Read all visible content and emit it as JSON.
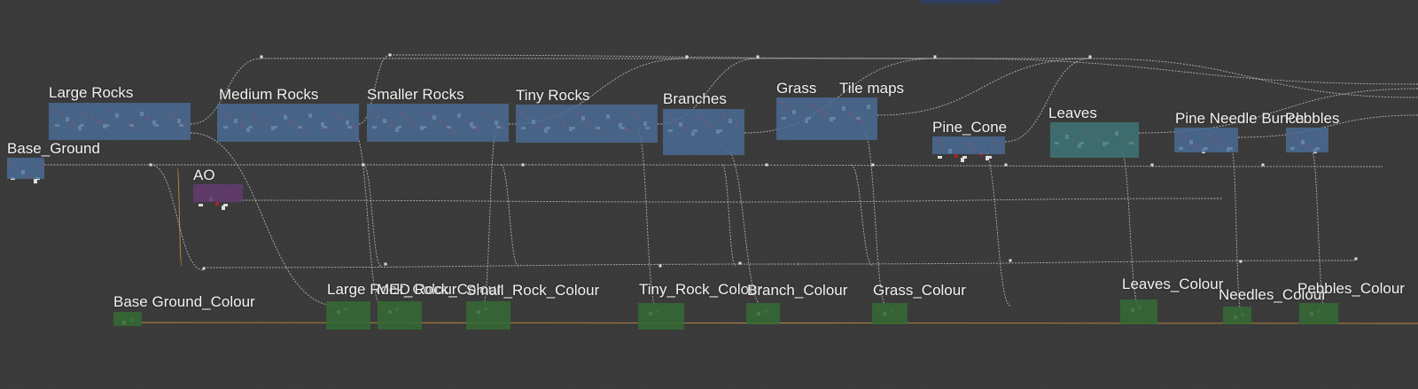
{
  "colors": {
    "background": "#3a3a3a",
    "wire": "#c8c8c8",
    "orange_wire": "#d89a3a",
    "node_red": "#a02525",
    "node_white": "#dddddd",
    "node_green": "#59a84f"
  },
  "frames": {
    "large_rocks": "Large Rocks",
    "medium_rocks": "Medium  Rocks",
    "smaller_rocks": "Smaller Rocks",
    "tiny_rocks": "Tiny Rocks",
    "branches": "Branches",
    "grass": "Grass",
    "tile_maps": "Tile maps",
    "pine_cone": "Pine_Cone",
    "leaves": "Leaves",
    "pine_needle_bunch": "Pine Needle Bunch",
    "pebbles": "Pebbles",
    "base_ground": "Base_Ground",
    "ao": "AO",
    "base_ground_colour": "Base Ground_Colour",
    "large_rock_colour": "Large Rock_Colour",
    "med_rock_colour": "MED Rock_Colour",
    "small_rock_colour": "Small_Rock_Colour",
    "tiny_rock_colour": "Tiny_Rock_Colour",
    "branch_colour": "Branch_Colour",
    "grass_colour": "Grass_Colour",
    "leaves_colour": "Leaves_Colour",
    "needles_colour": "Needles_Colour",
    "pebbles_colour": "Pebbles_Colour"
  }
}
